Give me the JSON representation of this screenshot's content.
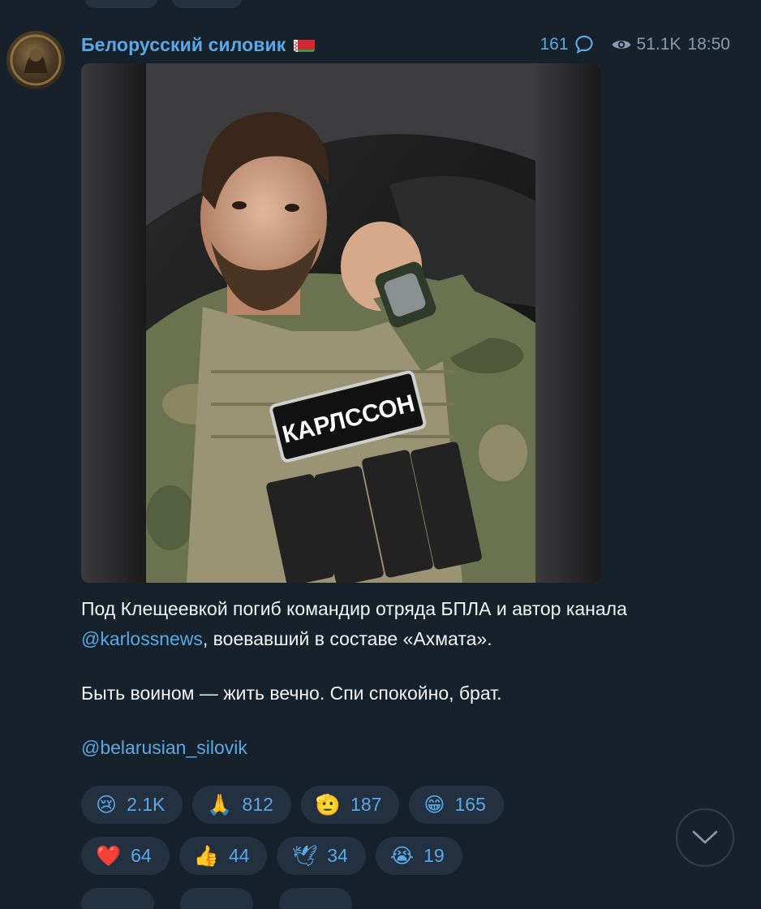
{
  "channel": {
    "name": "Белорусский силовик",
    "comments_count": "161",
    "views": "51.1K",
    "time": "18:50"
  },
  "post": {
    "patch_text": "КАРЛССОН",
    "text_part1": "Под Клещеевкой погиб командир отряда БПЛА и автор канала ",
    "mention_author": "@karlossnews",
    "text_part2": ", воевавший в составе «Ахмата».",
    "text_line2": "Быть воином — жить вечно. Спи спокойно, брат.",
    "signature": "@belarusian_silovik"
  },
  "reactions": [
    {
      "emoji": "😢",
      "count": "2.1K"
    },
    {
      "emoji": "🙏",
      "count": "812"
    },
    {
      "emoji": "🫡",
      "count": "187"
    },
    {
      "emoji": "😁",
      "count": "165"
    },
    {
      "emoji": "❤️",
      "count": "64"
    },
    {
      "emoji": "👍",
      "count": "44"
    },
    {
      "emoji": "🕊",
      "count": "34"
    },
    {
      "emoji": "😭",
      "count": "19"
    }
  ],
  "icons": {
    "comments": "comment-bubble-icon",
    "views": "eye-icon",
    "scroll": "chevron-down-icon"
  },
  "colors": {
    "background": "#17212b",
    "accent": "#5aa8e6",
    "pill": "#22303f",
    "muted": "#8a9aab"
  }
}
